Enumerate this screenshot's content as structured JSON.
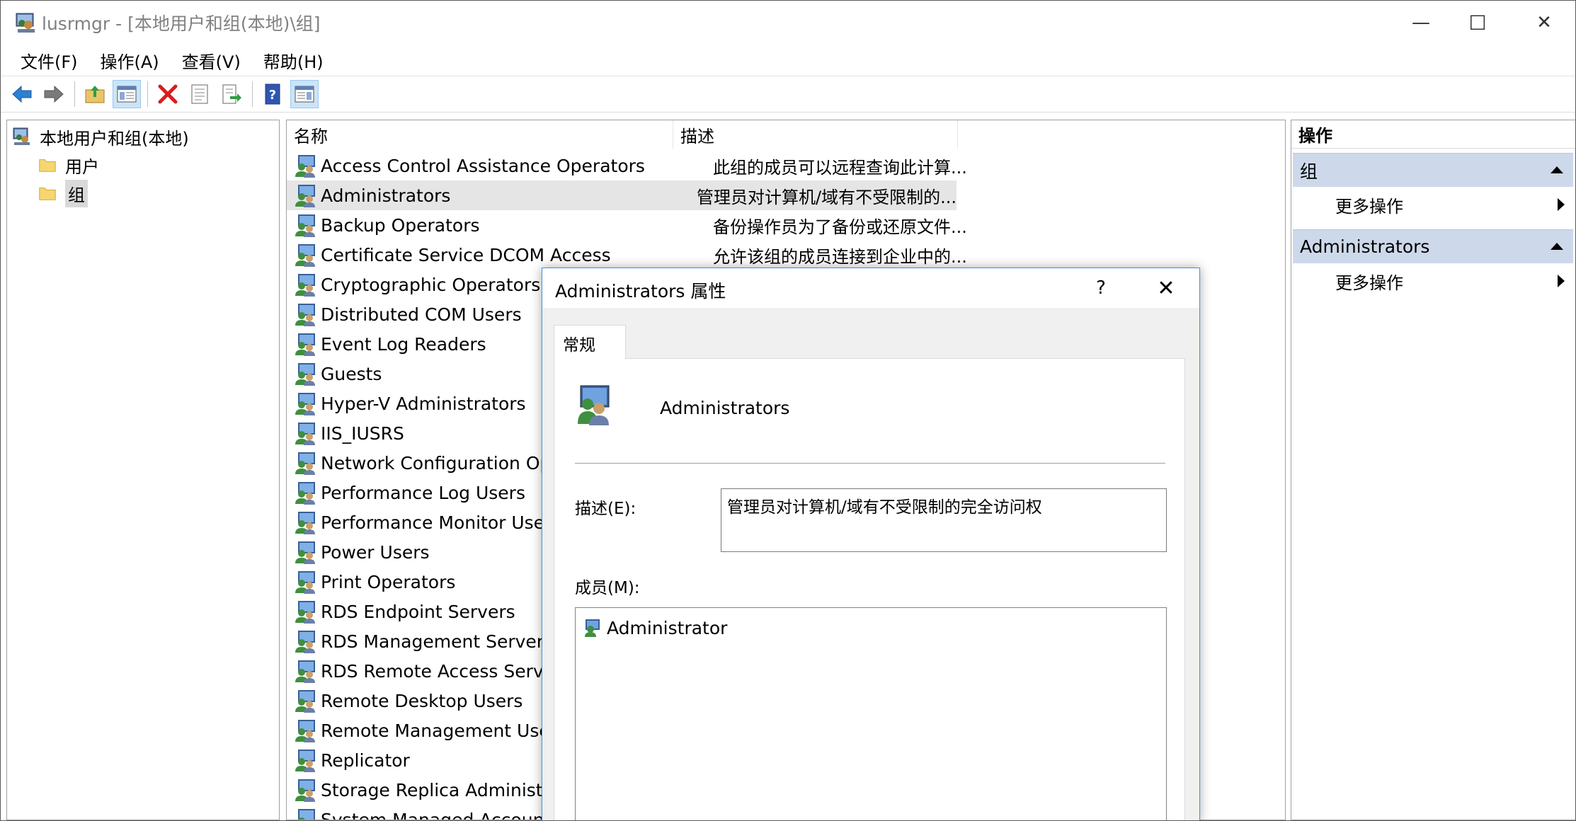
{
  "window": {
    "title": "lusrmgr - [本地用户和组(本地)\\组]",
    "icon": "users-mmc-icon",
    "controls": {
      "minimize": "—",
      "maximize": "☐",
      "close": "✕"
    }
  },
  "menubar": {
    "items": [
      "文件(F)",
      "操作(A)",
      "查看(V)",
      "帮助(H)"
    ]
  },
  "toolbar": {
    "buttons": [
      "back-arrow-icon",
      "forward-arrow-icon",
      "up-folder-icon",
      "show-hide-tree-icon",
      "delete-icon",
      "properties-icon",
      "export-list-icon",
      "help-icon",
      "show-hide-action-pane-icon"
    ]
  },
  "tree": {
    "root": "本地用户和组(本地)",
    "children": [
      "用户",
      "组"
    ],
    "selected": "组"
  },
  "list": {
    "columns": {
      "name": "名称",
      "description": "描述"
    },
    "rows": [
      {
        "name": "Access Control Assistance Operators",
        "description": "此组的成员可以远程查询此计算..."
      },
      {
        "name": "Administrators",
        "description": "管理员对计算机/域有不受限制的..."
      },
      {
        "name": "Backup Operators",
        "description": "备份操作员为了备份或还原文件..."
      },
      {
        "name": "Certificate Service DCOM Access",
        "description": "允许该组的成员连接到企业中的..."
      },
      {
        "name": "Cryptographic Operators",
        "description": ""
      },
      {
        "name": "Distributed COM Users",
        "description": ""
      },
      {
        "name": "Event Log Readers",
        "description": ""
      },
      {
        "name": "Guests",
        "description": ""
      },
      {
        "name": "Hyper-V Administrators",
        "description": ""
      },
      {
        "name": "IIS_IUSRS",
        "description": ""
      },
      {
        "name": "Network Configuration Ope",
        "description": ""
      },
      {
        "name": "Performance Log Users",
        "description": ""
      },
      {
        "name": "Performance Monitor User",
        "description": ""
      },
      {
        "name": "Power Users",
        "description": ""
      },
      {
        "name": "Print Operators",
        "description": ""
      },
      {
        "name": "RDS Endpoint Servers",
        "description": ""
      },
      {
        "name": "RDS Management Servers",
        "description": ""
      },
      {
        "name": "RDS Remote Access Server",
        "description": ""
      },
      {
        "name": "Remote Desktop Users",
        "description": ""
      },
      {
        "name": "Remote Management User",
        "description": ""
      },
      {
        "name": "Replicator",
        "description": ""
      },
      {
        "name": "Storage Replica Administra",
        "description": ""
      },
      {
        "name": "System Managed Accounts",
        "description": ""
      }
    ],
    "selected_index": 1
  },
  "actions": {
    "title": "操作",
    "sections": [
      {
        "header": "组",
        "item": "更多操作"
      },
      {
        "header": "Administrators",
        "item": "更多操作"
      }
    ]
  },
  "dialog": {
    "title": "Administrators 属性",
    "help": "?",
    "close": "✕",
    "tab": "常规",
    "group_name": "Administrators",
    "description_label": "描述(E):",
    "description_value": "管理员对计算机/域有不受限制的完全访问权",
    "members_label": "成员(M):",
    "members": [
      "Administrator"
    ]
  },
  "colors": {
    "selection_blue": "#cce4f7",
    "action_header": "#cdd9ea",
    "dialog_border": "#4a90d9"
  }
}
